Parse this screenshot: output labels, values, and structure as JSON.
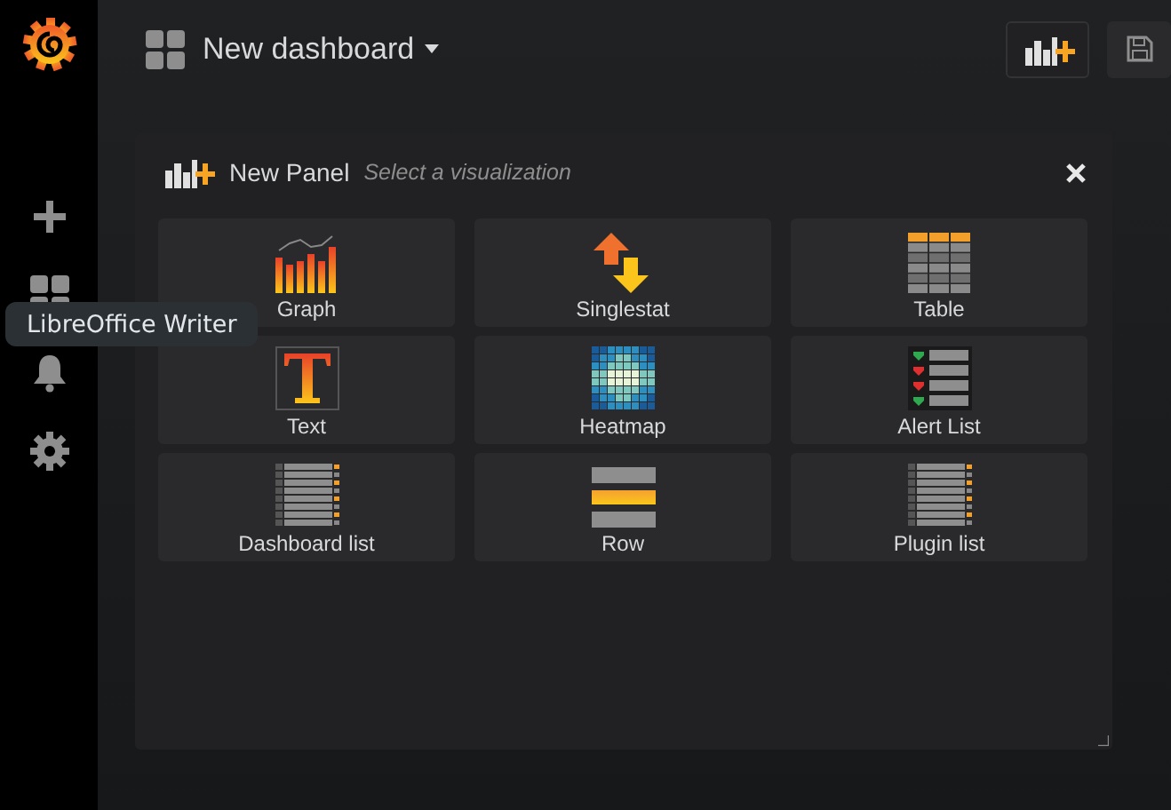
{
  "sidebar": {
    "items": [
      {
        "kind": "create"
      },
      {
        "kind": "dashboards"
      },
      {
        "kind": "alerts"
      },
      {
        "kind": "settings"
      }
    ],
    "tooltip": "LibreOffice Writer"
  },
  "header": {
    "title": "New dashboard"
  },
  "panel": {
    "title": "New Panel",
    "subtitle": "Select a visualization",
    "visualizations": [
      {
        "label": "Graph",
        "kind": "graph"
      },
      {
        "label": "Singlestat",
        "kind": "singlestat"
      },
      {
        "label": "Table",
        "kind": "table"
      },
      {
        "label": "Text",
        "kind": "text"
      },
      {
        "label": "Heatmap",
        "kind": "heatmap"
      },
      {
        "label": "Alert List",
        "kind": "alertlist"
      },
      {
        "label": "Dashboard list",
        "kind": "list"
      },
      {
        "label": "Row",
        "kind": "row"
      },
      {
        "label": "Plugin list",
        "kind": "list"
      }
    ]
  }
}
